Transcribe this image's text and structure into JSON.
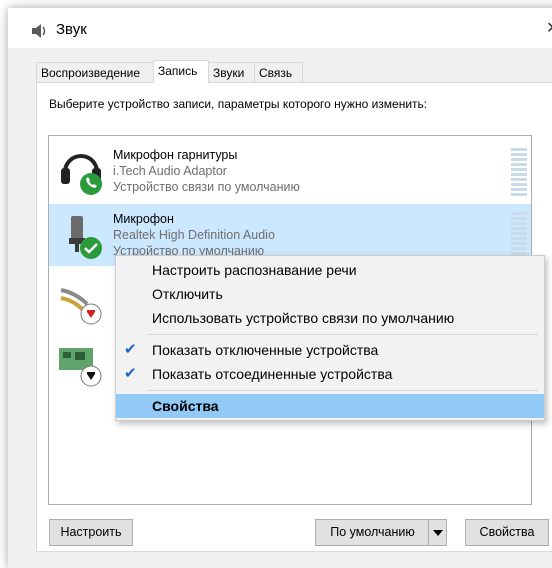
{
  "window": {
    "title": "Звук",
    "icon": "speaker-icon"
  },
  "tabs": [
    {
      "label": "Воспроизведение"
    },
    {
      "label": "Запись"
    },
    {
      "label": "Звуки"
    },
    {
      "label": "Связь"
    }
  ],
  "active_tab": "Запись",
  "instruction": "Выберите устройство записи, параметры которого нужно изменить:",
  "devices": [
    {
      "name": "Микрофон гарнитуры",
      "driver": "i.Tech Audio Adaptor",
      "status": "Устройство связи по умолчанию",
      "icon": "headset-icon",
      "badge": "phone-badge-icon"
    },
    {
      "name": "Микрофон",
      "driver": "Realtek High Definition Audio",
      "status": "Устройство по умолчанию",
      "icon": "microphone-icon",
      "badge": "check-badge-icon",
      "selected": true
    },
    {
      "name": "",
      "icon": "line-in-cable-icon",
      "badge": "disabled-down-arrow-icon"
    },
    {
      "name": "",
      "icon": "sound-card-icon",
      "badge": "disconnected-down-arrow-icon"
    }
  ],
  "context_menu": {
    "items": [
      {
        "label": "Настроить распознавание речи"
      },
      {
        "label": "Отключить"
      },
      {
        "label": "Использовать устройство связи по умолчанию"
      },
      {
        "label": "Показать отключенные устройства",
        "checked": true
      },
      {
        "label": "Показать отсоединенные устройства",
        "checked": true
      },
      {
        "label": "Свойства",
        "highlighted": true
      }
    ]
  },
  "buttons": {
    "configure": "Настроить",
    "set_default": "По умолчанию",
    "properties": "Свойства"
  },
  "colors": {
    "selection": "#cce8ff",
    "menu_highlight": "#91c9f7",
    "check": "#1a64c8"
  }
}
